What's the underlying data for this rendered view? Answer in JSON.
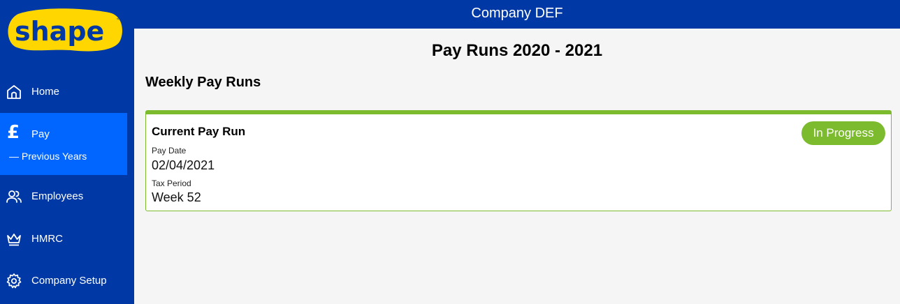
{
  "brand": {
    "logo_text": "shape",
    "logo_tm": "™"
  },
  "header": {
    "company": "Company DEF"
  },
  "sidebar": {
    "items": [
      {
        "label": "Home",
        "icon": "home-icon"
      },
      {
        "label": "Pay",
        "icon": "pound-icon",
        "glyph": "£",
        "sub_label": "— Previous Years",
        "active": true
      },
      {
        "label": "Employees",
        "icon": "users-icon"
      },
      {
        "label": "HMRC",
        "icon": "crown-icon"
      },
      {
        "label": "Company Setup",
        "icon": "gear-icon"
      }
    ]
  },
  "main": {
    "title": "Pay Runs 2020 - 2021",
    "section_title": "Weekly Pay Runs",
    "card": {
      "title": "Current Pay Run",
      "status": "In Progress",
      "pay_date_label": "Pay Date",
      "pay_date": "02/04/2021",
      "tax_period_label": "Tax Period",
      "tax_period": "Week 52"
    }
  },
  "colors": {
    "nav_bg": "#0039a6",
    "nav_active": "#0066ff",
    "logo_yellow": "#ffd600",
    "accent_green": "#7cbb2e",
    "page_bg": "#f5f5f5"
  }
}
